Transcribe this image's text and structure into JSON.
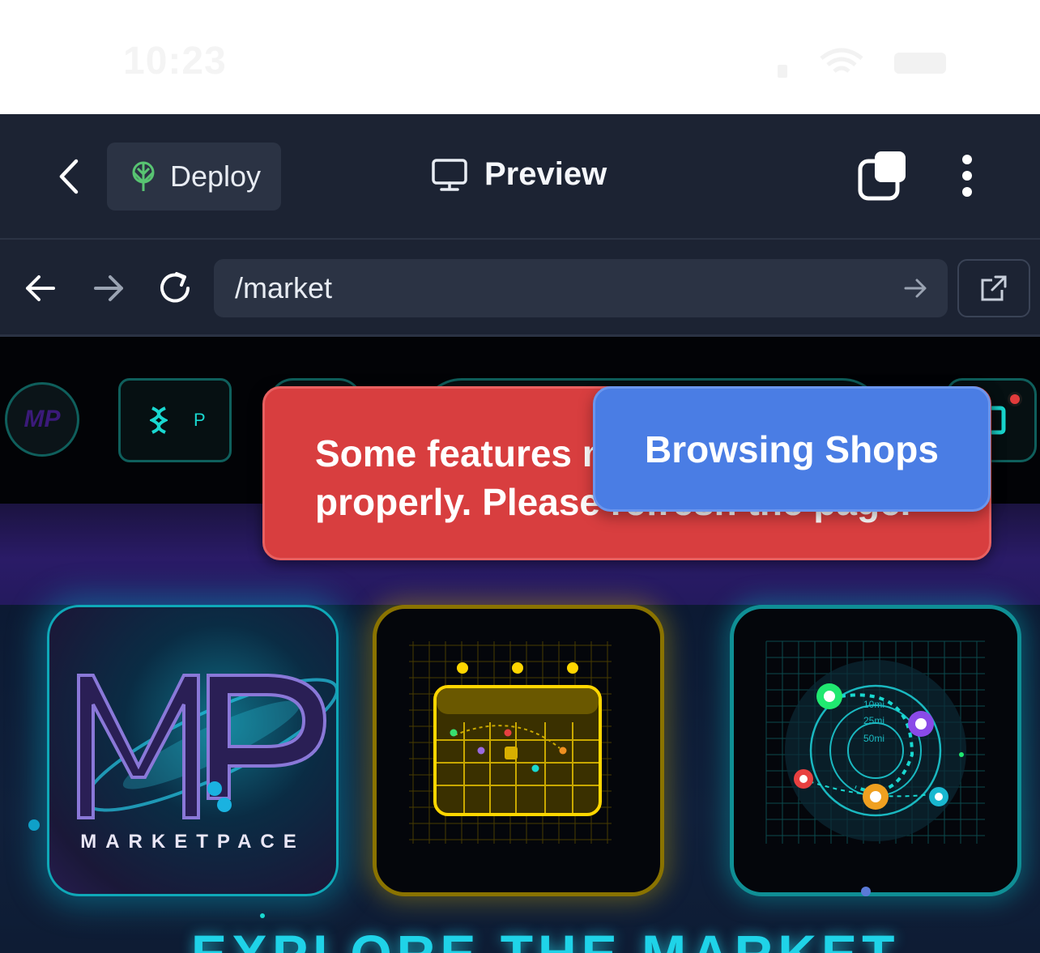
{
  "status_bar": {
    "time": "10:23"
  },
  "toolbar": {
    "deploy_label": "Deploy",
    "preview_label": "Preview"
  },
  "urlbar": {
    "url": "/market"
  },
  "header": {
    "avatar_text": "MP",
    "points_label": "P",
    "notification": true
  },
  "toasts": {
    "error_text": "Some features may not work properly. Please refresh the page.",
    "info_text": "Browsing Shops"
  },
  "tiles": {
    "logo_word": "MARKETPACE",
    "radar_rings": [
      "10mi",
      "25mi",
      "50mi"
    ]
  },
  "hero": {
    "title": "EXPLORE THE MARKET"
  },
  "colors": {
    "toolbar_bg": "#1c2333",
    "error_toast": "#d83e3f",
    "info_toast": "#4a7de4",
    "accent_cyan": "#1fd3e8",
    "accent_yellow": "#ffd600",
    "deploy_icon_green": "#58c472"
  }
}
